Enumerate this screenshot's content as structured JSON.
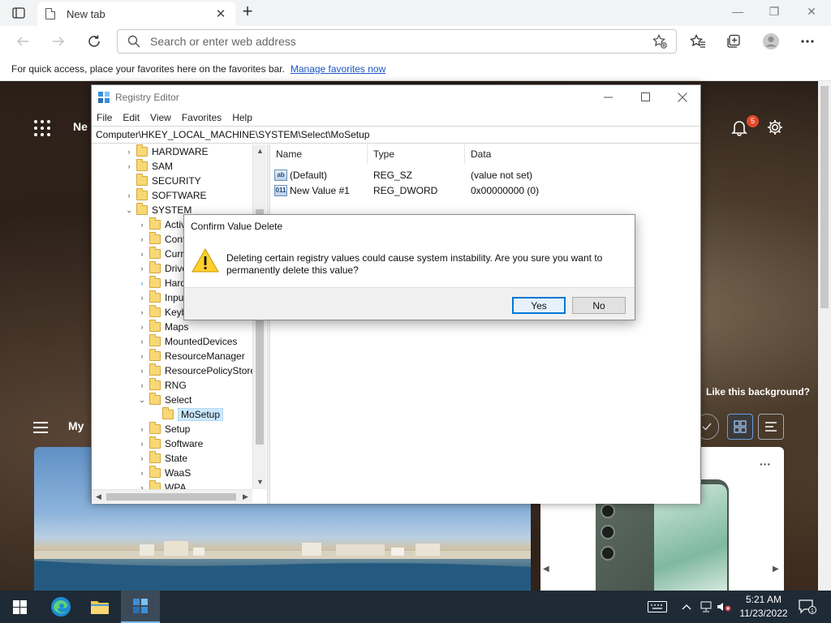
{
  "browser": {
    "tab_title": "New tab",
    "tab_close": "✕",
    "new_tab": "+",
    "address_placeholder": "Search or enter web address",
    "favbar_message": "For quick access, place your favorites here on the favorites bar.",
    "favbar_link": "Manage favorites now",
    "win_min": "—",
    "win_restore": "❐",
    "win_close": "✕"
  },
  "ntp": {
    "title_fragment": "Ne",
    "notification_count": "5",
    "like_background": "Like this background?",
    "feed_fragment": "My",
    "card_more": "···"
  },
  "regedit": {
    "title": "Registry Editor",
    "menu": [
      "File",
      "Edit",
      "View",
      "Favorites",
      "Help"
    ],
    "path": "Computer\\HKEY_LOCAL_MACHINE\\SYSTEM\\Select\\MoSetup",
    "tree": [
      {
        "label": "HARDWARE",
        "level": 1,
        "chev": "›"
      },
      {
        "label": "SAM",
        "level": 1,
        "chev": "›"
      },
      {
        "label": "SECURITY",
        "level": 1,
        "chev": ""
      },
      {
        "label": "SOFTWARE",
        "level": 1,
        "chev": "›"
      },
      {
        "label": "SYSTEM",
        "level": 1,
        "chev": "⌄"
      },
      {
        "label": "Activ",
        "level": 2,
        "chev": "›"
      },
      {
        "label": "Cont",
        "level": 2,
        "chev": "›"
      },
      {
        "label": "Curr",
        "level": 2,
        "chev": "›"
      },
      {
        "label": "Drive",
        "level": 2,
        "chev": "›"
      },
      {
        "label": "Hard",
        "level": 2,
        "chev": "›",
        "blue": true
      },
      {
        "label": "Inpu",
        "level": 2,
        "chev": "›"
      },
      {
        "label": "Keyb",
        "level": 2,
        "chev": "›"
      },
      {
        "label": "Maps",
        "level": 2,
        "chev": "›"
      },
      {
        "label": "MountedDevices",
        "level": 2,
        "chev": "›"
      },
      {
        "label": "ResourceManager",
        "level": 2,
        "chev": "›"
      },
      {
        "label": "ResourcePolicyStore",
        "level": 2,
        "chev": "›"
      },
      {
        "label": "RNG",
        "level": 2,
        "chev": "›"
      },
      {
        "label": "Select",
        "level": 2,
        "chev": "⌄"
      },
      {
        "label": "MoSetup",
        "level": 3,
        "chev": "",
        "selected": true
      },
      {
        "label": "Setup",
        "level": 2,
        "chev": "›"
      },
      {
        "label": "Software",
        "level": 2,
        "chev": "›"
      },
      {
        "label": "State",
        "level": 2,
        "chev": "›"
      },
      {
        "label": "WaaS",
        "level": 2,
        "chev": "›"
      },
      {
        "label": "WPA",
        "level": 2,
        "chev": "›"
      }
    ],
    "columns": {
      "name": "Name",
      "type": "Type",
      "data": "Data"
    },
    "values": [
      {
        "icon": "ab",
        "name": "(Default)",
        "type": "REG_SZ",
        "data": "(value not set)"
      },
      {
        "icon": "011",
        "name": "New Value #1",
        "type": "REG_DWORD",
        "data": "0x00000000 (0)"
      }
    ]
  },
  "dialog": {
    "title": "Confirm Value Delete",
    "message": "Deleting certain registry values could cause system instability. Are you sure you want to permanently delete this value?",
    "yes": "Yes",
    "no": "No"
  },
  "taskbar": {
    "time": "5:21 AM",
    "date": "11/23/2022",
    "notification_count": "1"
  },
  "colors": {
    "accent": "#0078d7",
    "taskbar": "#1e2a36",
    "link": "#1a57c4",
    "badge": "#e5492b"
  }
}
